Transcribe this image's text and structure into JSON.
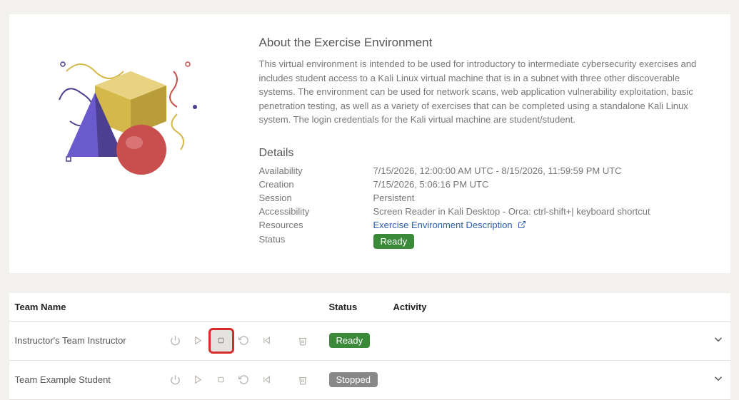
{
  "about": {
    "heading": "About the Exercise Environment",
    "text": "This virtual environment is intended to be used for introductory to intermediate cybersecurity exercises and includes student access to a Kali Linux virtual machine that is in a subnet with three other discoverable systems. The environment can be used for network scans, web application vulnerability exploitation, basic penetration testing, as well as a variety of exercises that can be completed using a standalone Kali Linux system. The login credentials for the Kali virtual machine are student/student."
  },
  "details": {
    "heading": "Details",
    "rows": {
      "availability_label": "Availability",
      "availability_value": "7/15/2026, 12:00:00 AM UTC - 8/15/2026, 11:59:59 PM UTC",
      "creation_label": "Creation",
      "creation_value": "7/15/2026, 5:06:16 PM UTC",
      "session_label": "Session",
      "session_value": "Persistent",
      "accessibility_label": "Accessibility",
      "accessibility_value": "Screen Reader in Kali Desktop - Orca: ctrl-shift+| keyboard shortcut",
      "resources_label": "Resources",
      "resources_link": "Exercise Environment Description",
      "status_label": "Status",
      "status_value": "Ready"
    }
  },
  "table": {
    "headers": {
      "team_name": "Team Name",
      "status": "Status",
      "activity": "Activity"
    },
    "rows": [
      {
        "name": "Instructor's Team Instructor",
        "status": "Ready",
        "status_class": "ready"
      },
      {
        "name": "Team Example Student",
        "status": "Stopped",
        "status_class": "stopped"
      }
    ]
  }
}
